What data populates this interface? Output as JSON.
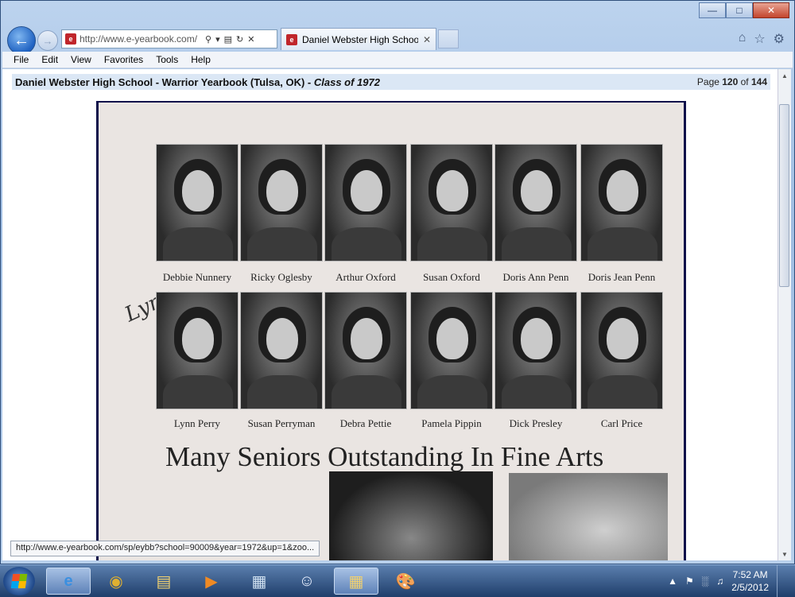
{
  "browser": {
    "address": "http://www.e-yearbook.com/",
    "tab_title": "Daniel Webster High Schoo...",
    "favicon_text": "e",
    "menu": [
      "File",
      "Edit",
      "View",
      "Favorites",
      "Tools",
      "Help"
    ],
    "status_url": "http://www.e-yearbook.com/sp/eybb?school=90009&year=1972&up=1&zoo..."
  },
  "yearbook": {
    "title": "Daniel Webster High School - Warrior Yearbook (Tulsa, OK) - ",
    "class_label": "Class of 1972",
    "page_prefix": "Page ",
    "page_current": "120",
    "page_of": " of ",
    "page_total": "144",
    "row1_names": [
      "Debbie Nunnery",
      "Ricky Oglesby",
      "Arthur Oxford",
      "Susan Oxford",
      "Doris Ann Penn",
      "Doris Jean Penn"
    ],
    "row2_names": [
      "Lynn Perry",
      "Susan Perryman",
      "Debra Pettie",
      "Pamela Pippin",
      "Dick Presley",
      "Carl Price"
    ],
    "signature": "Lynn",
    "headline": "Many Seniors Outstanding In Fine Arts"
  },
  "taskbar": {
    "time": "7:52 AM",
    "date": "2/5/2012"
  }
}
